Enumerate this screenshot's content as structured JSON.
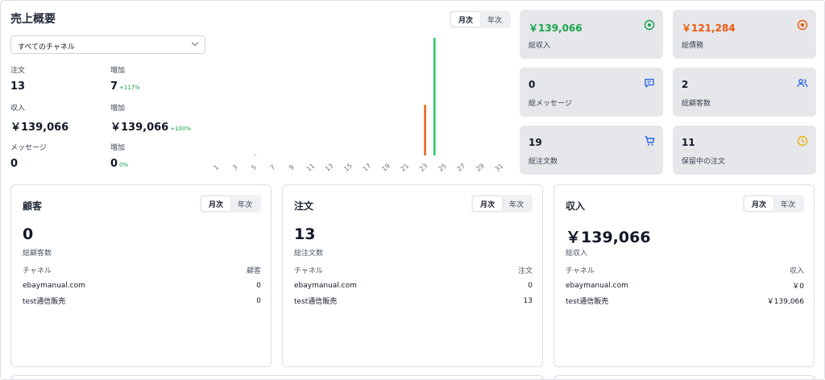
{
  "overview": {
    "title": "売上概要",
    "channel_select": "すべてのチャネル",
    "toggle": [
      "月次",
      "年次"
    ],
    "stats": [
      {
        "label": "注文",
        "value": "13"
      },
      {
        "label": "増加",
        "value": "7",
        "pct": "+117%"
      },
      {
        "label": "収入",
        "value": "￥139,066"
      },
      {
        "label": "増加",
        "value": "￥139,066",
        "pct": "+100%"
      },
      {
        "label": "メッセージ",
        "value": "0"
      },
      {
        "label": "増加",
        "value": "0",
        "pct": "0%"
      }
    ]
  },
  "chart_data": {
    "type": "bar",
    "x": [
      "1",
      "3",
      "5",
      "7",
      "9",
      "11",
      "13",
      "15",
      "17",
      "19",
      "21",
      "23",
      "25",
      "27",
      "29",
      "31"
    ],
    "series": [
      {
        "color": "#ea580c",
        "points": [
          {
            "day": 23,
            "value": 0.43
          }
        ]
      },
      {
        "color": "#22c55e",
        "points": [
          {
            "day": 24,
            "value": 1.0
          }
        ]
      }
    ],
    "grid": false,
    "legend": "none"
  },
  "tiles": [
    {
      "value": "￥139,066",
      "label": "総収入",
      "color": "#16a34a",
      "icon": "dollar-circle-icon",
      "icon_color": "#16a34a"
    },
    {
      "value": "￥121,284",
      "label": "総債務",
      "color": "#ea580c",
      "icon": "target-circle-icon",
      "icon_color": "#ea580c"
    },
    {
      "value": "0",
      "label": "総メッセージ",
      "color": "#111827",
      "icon": "message-icon",
      "icon_color": "#2563eb"
    },
    {
      "value": "2",
      "label": "総顧客数",
      "color": "#111827",
      "icon": "users-icon",
      "icon_color": "#2563eb"
    },
    {
      "value": "19",
      "label": "総注文数",
      "color": "#111827",
      "icon": "cart-icon",
      "icon_color": "#2563eb"
    },
    {
      "value": "11",
      "label": "保留中の注文",
      "color": "#111827",
      "icon": "clock-icon",
      "icon_color": "#eab308"
    }
  ],
  "cards": [
    {
      "title": "顧客",
      "toggle": [
        "月次",
        "年次"
      ],
      "big": "0",
      "sub": "総顧客数",
      "headers": [
        "チャネル",
        "顧客"
      ],
      "rows": [
        [
          "ebaymanual.com",
          "0"
        ],
        [
          "test通信販売",
          "0"
        ]
      ]
    },
    {
      "title": "注文",
      "toggle": [
        "月次",
        "年次"
      ],
      "big": "13",
      "sub": "総注文数",
      "headers": [
        "チャネル",
        "注文"
      ],
      "rows": [
        [
          "ebaymanual.com",
          "0"
        ],
        [
          "test通信販売",
          "13"
        ]
      ]
    },
    {
      "title": "収入",
      "toggle": [
        "月次",
        "年次"
      ],
      "big": "￥139,066",
      "sub": "総収入",
      "headers": [
        "チャネル",
        "収入"
      ],
      "rows": [
        [
          "ebaymanual.com",
          "￥0"
        ],
        [
          "test通信販売",
          "￥139,066"
        ]
      ]
    }
  ]
}
